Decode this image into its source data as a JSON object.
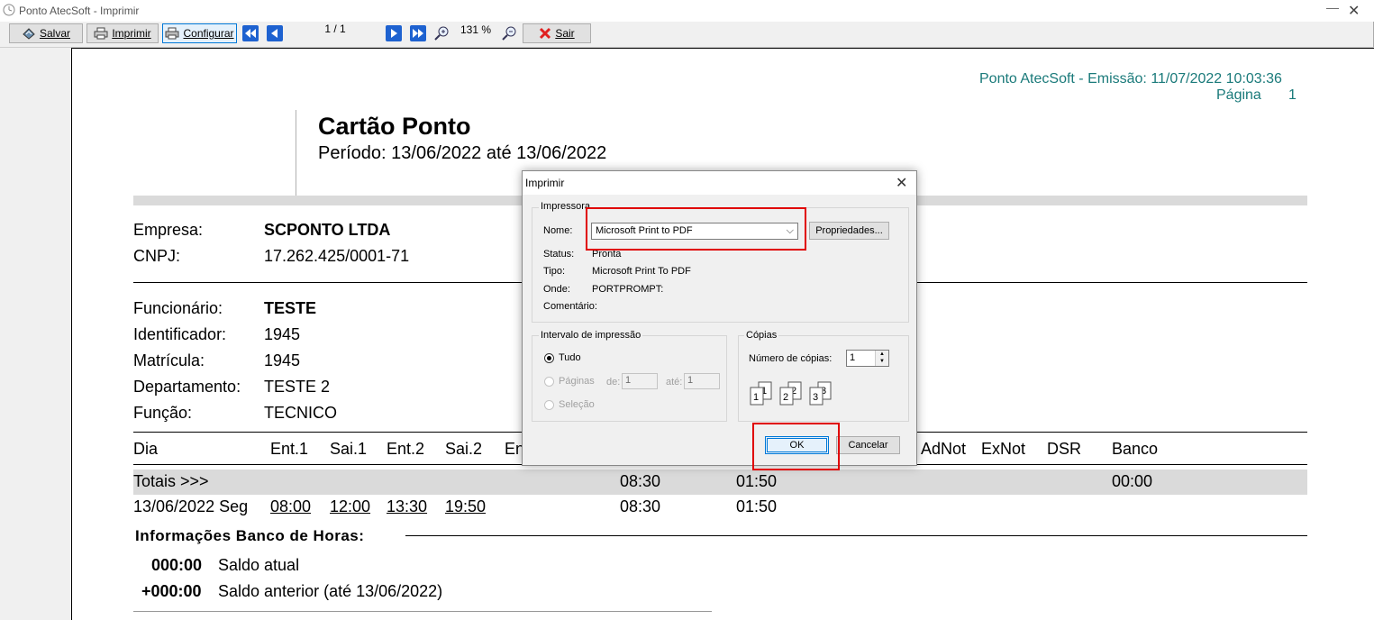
{
  "window": {
    "title": "Ponto AtecSoft - Imprimir"
  },
  "toolbar": {
    "save_label": "Salvar",
    "print_label": "Imprimir",
    "configure_label": "Configurar",
    "page_indicator": "1 / 1",
    "zoom_value": "131 %",
    "exit_label": "Sair"
  },
  "report": {
    "emission": "Ponto AtecSoft - Emissão: 11/07/2022 10:03:36",
    "page_label": "Página",
    "page_number": "1",
    "title": "Cartão Ponto",
    "period": "Período: 13/06/2022 até 13/06/2022",
    "company_label": "Empresa:",
    "company_value": "SCPONTO LTDA",
    "cnpj_label": "CNPJ:",
    "cnpj_value": "17.262.425/0001-71",
    "employee_label": "Funcionário:",
    "employee_value": "TESTE",
    "identifier_label": "Identificador:",
    "identifier_value": "1945",
    "registration_label": "Matrícula:",
    "registration_value": "1945",
    "department_label": "Departamento:",
    "department_value": "TESTE 2",
    "role_label": "Função:",
    "role_value": "TECNICO",
    "columns": {
      "dia": "Dia",
      "ent1": "Ent.1",
      "sai1": "Sai.1",
      "ent2": "Ent.2",
      "sai2": "Sai.2",
      "en_partial": "En",
      "adnot": "AdNot",
      "exnot": "ExNot",
      "dsr": "DSR",
      "banco": "Banco"
    },
    "totals": {
      "label": "Totais >>>",
      "v1": "08:30",
      "v2": "01:50",
      "banco": "00:00"
    },
    "row": {
      "date": "13/06/2022 Seg",
      "ent1": "08:00",
      "sai1": "12:00",
      "ent2": "13:30",
      "sai2": "19:50",
      "v1": "08:30",
      "v2": "01:50"
    },
    "bank_title": "Informações Banco de Horas:",
    "bank_current_value": "000:00",
    "bank_current_label": "Saldo atual",
    "bank_previous_value": "+000:00",
    "bank_previous_label": "Saldo anterior (até 13/06/2022)"
  },
  "dialog": {
    "title": "Imprimir",
    "printer_group": "Impressora",
    "name_label": "Nome:",
    "printer_selected": "Microsoft Print to PDF",
    "properties_button": "Propriedades...",
    "status_label": "Status:",
    "status_value": "Pronta",
    "type_label": "Tipo:",
    "type_value": "Microsoft Print To PDF",
    "where_label": "Onde:",
    "where_value": "PORTPROMPT:",
    "comment_label": "Comentário:",
    "range_group": "Intervalo de impressão",
    "range_all": "Tudo",
    "range_pages": "Páginas",
    "from_label": "de:",
    "from_value": "1",
    "to_label": "até:",
    "to_value": "1",
    "range_selection": "Seleção",
    "copies_group": "Cópias",
    "copies_label": "Número de cópias:",
    "copies_value": "1",
    "collate_icons": [
      "1",
      "1",
      "2",
      "2",
      "3",
      "3"
    ],
    "ok_button": "OK",
    "cancel_button": "Cancelar"
  },
  "colors": {
    "accent_teal": "#1a7a7a",
    "highlight_red": "#e00000",
    "focus_blue": "#0078d7"
  }
}
